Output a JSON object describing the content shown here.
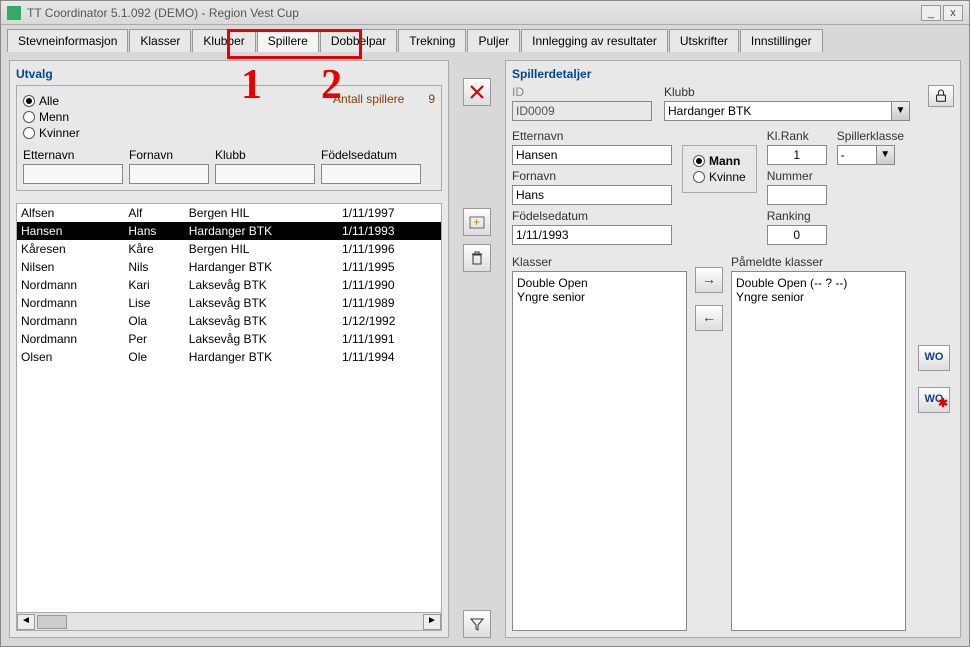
{
  "window": {
    "title": "TT Coordinator 5.1.092 (DEMO) - Region Vest Cup"
  },
  "tabs": {
    "items": [
      "Stevneinformasjon",
      "Klasser",
      "Klubber",
      "Spillere",
      "Dobbelpar",
      "Trekning",
      "Puljer",
      "Innlegging av resultater",
      "Utskrifter",
      "Innstillinger"
    ],
    "active_index": 3
  },
  "annotations": {
    "n1": "1",
    "n2": "2"
  },
  "utvalg": {
    "title": "Utvalg",
    "radios": {
      "alle": "Alle",
      "menn": "Menn",
      "kvinner": "Kvinner",
      "selected": "alle"
    },
    "count_label": "Antall spillere",
    "count_value": "9",
    "filters": {
      "etternavn": {
        "label": "Etternavn",
        "value": ""
      },
      "fornavn": {
        "label": "Fornavn",
        "value": ""
      },
      "klubb": {
        "label": "Klubb",
        "value": ""
      },
      "fodsel": {
        "label": "Födelsedatum",
        "value": ""
      }
    },
    "rows": [
      {
        "e": "Alfsen",
        "f": "Alf",
        "k": "Bergen HIL",
        "d": "1/11/1997"
      },
      {
        "e": "Hansen",
        "f": "Hans",
        "k": "Hardanger BTK",
        "d": "1/11/1993"
      },
      {
        "e": "Kåresen",
        "f": "Kåre",
        "k": "Bergen HIL",
        "d": "1/11/1996"
      },
      {
        "e": "Nilsen",
        "f": "Nils",
        "k": "Hardanger BTK",
        "d": "1/11/1995"
      },
      {
        "e": "Nordmann",
        "f": "Kari",
        "k": "Laksevåg BTK",
        "d": "1/11/1990"
      },
      {
        "e": "Nordmann",
        "f": "Lise",
        "k": "Laksevåg BTK",
        "d": "1/11/1989"
      },
      {
        "e": "Nordmann",
        "f": "Ola",
        "k": "Laksevåg BTK",
        "d": "1/12/1992"
      },
      {
        "e": "Nordmann",
        "f": "Per",
        "k": "Laksevåg BTK",
        "d": "1/11/1991"
      },
      {
        "e": "Olsen",
        "f": "Ole",
        "k": "Hardanger BTK",
        "d": "1/11/1994"
      }
    ],
    "selected_row": 1
  },
  "details": {
    "title": "Spillerdetaljer",
    "id_label": "ID",
    "id_value": "ID0009",
    "klubb_label": "Klubb",
    "klubb_value": "Hardanger BTK",
    "etternavn_label": "Etternavn",
    "etternavn_value": "Hansen",
    "fornavn_label": "Fornavn",
    "fornavn_value": "Hans",
    "fodsel_label": "Födelsedatum",
    "fodsel_value": "1/11/1993",
    "gender_mann": "Mann",
    "gender_kvinne": "Kvinne",
    "gender_selected": "mann",
    "klrank_label": "Kl.Rank",
    "klrank_value": "1",
    "spillerklasse_label": "Spillerklasse",
    "spillerklasse_value": "-",
    "nummer_label": "Nummer",
    "nummer_value": "",
    "ranking_label": "Ranking",
    "ranking_value": "0",
    "klasser_label": "Klasser",
    "klasser_items": [
      "Double Open",
      "Yngre senior"
    ],
    "paameldte_label": "Påmeldte klasser",
    "paameldte_items": [
      "Double Open (-- ? --)",
      "Yngre senior"
    ],
    "wo_label": "WO"
  }
}
